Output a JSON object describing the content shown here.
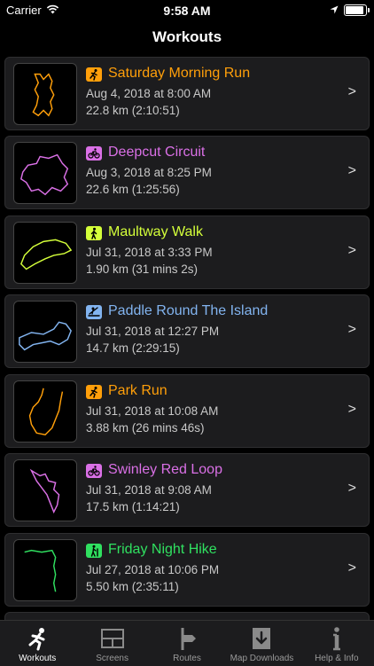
{
  "status": {
    "carrier": "Carrier",
    "time": "9:58 AM",
    "battery_level": 0.9
  },
  "nav": {
    "title": "Workouts"
  },
  "workouts": [
    {
      "title": "Saturday Morning Run",
      "date": "Aug 4, 2018 at 8:00 AM",
      "distance": "22.8 km (2:10:51)",
      "color": "#ff9f0a",
      "icon": "running-icon"
    },
    {
      "title": "Deepcut Circuit",
      "date": "Aug 3, 2018 at 8:25 PM",
      "distance": "22.6 km (1:25:56)",
      "color": "#da70e6",
      "icon": "cycling-icon"
    },
    {
      "title": "Maultway Walk",
      "date": "Jul 31, 2018 at 3:33 PM",
      "distance": "1.90 km (31 mins 2s)",
      "color": "#d4ff3a",
      "icon": "walking-icon"
    },
    {
      "title": "Paddle Round The Island",
      "date": "Jul 31, 2018 at 12:27 PM",
      "distance": "14.7 km (2:29:15)",
      "color": "#82b4f0",
      "icon": "paddling-icon"
    },
    {
      "title": "Park Run",
      "date": "Jul 31, 2018 at 10:08 AM",
      "distance": "3.88 km (26 mins 46s)",
      "color": "#ff9f0a",
      "icon": "running-icon"
    },
    {
      "title": "Swinley Red Loop",
      "date": "Jul 31, 2018 at 9:08 AM",
      "distance": "17.5 km (1:14:21)",
      "color": "#da70e6",
      "icon": "cycling-icon"
    },
    {
      "title": "Friday Night Hike",
      "date": "Jul 27, 2018 at 10:06 PM",
      "distance": "5.50 km (2:35:11)",
      "color": "#30e060",
      "icon": "hiking-icon"
    }
  ],
  "chevron": ">",
  "tabs": [
    {
      "label": "Workouts",
      "icon": "runner-icon"
    },
    {
      "label": "Screens",
      "icon": "screens-grid-icon"
    },
    {
      "label": "Routes",
      "icon": "route-sign-icon"
    },
    {
      "label": "Map Downloads",
      "icon": "download-icon"
    },
    {
      "label": "Help & Info",
      "icon": "info-icon"
    }
  ]
}
